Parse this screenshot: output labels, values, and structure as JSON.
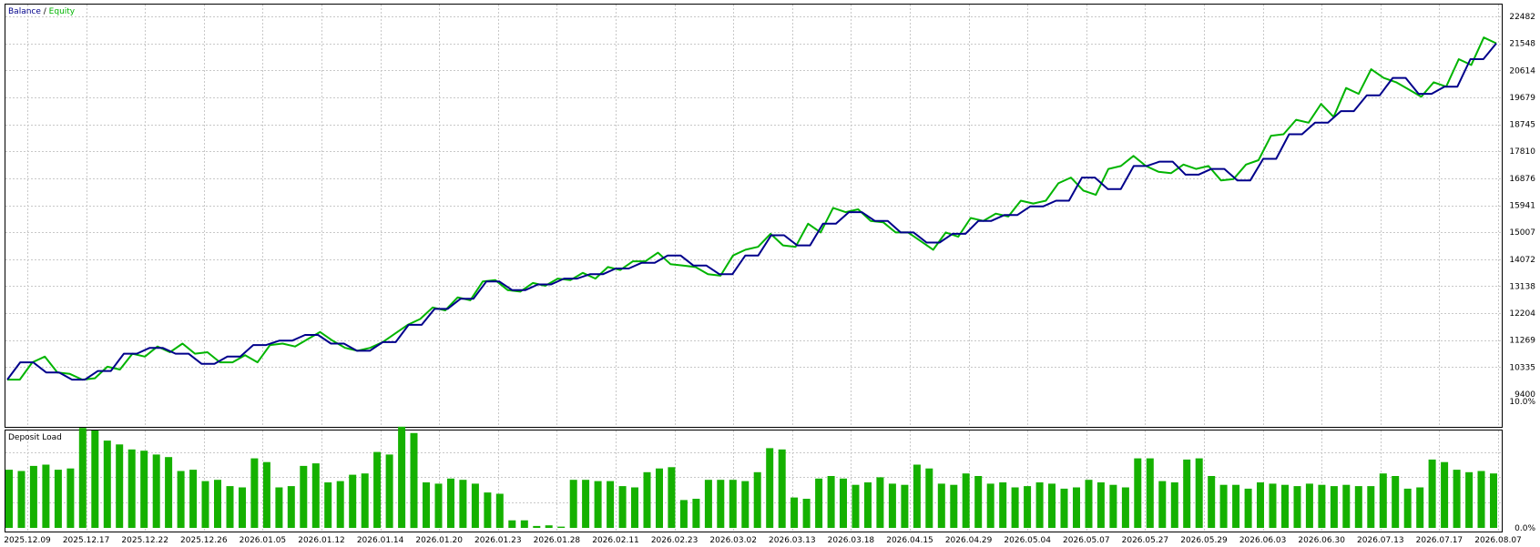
{
  "legend": {
    "balance_label": "Balance",
    "separator": " / ",
    "equity_label": "Equity"
  },
  "colors": {
    "balance": "#00008b",
    "equity": "#00b400",
    "deposit_bar": "#15b100",
    "grid": "#c8c8c8"
  },
  "chart_data": [
    {
      "type": "line",
      "y_ticks": [
        22482,
        21548,
        20614,
        19679,
        18745,
        17810,
        16876,
        15941,
        15007,
        14072,
        13138,
        12204,
        11269,
        10335,
        9400
      ],
      "ylim": [
        9400,
        22482
      ],
      "grid": true,
      "legend": "top-left",
      "series": [
        {
          "name": "Balance",
          "values": [
            9900,
            10500,
            10500,
            10150,
            10150,
            9900,
            9900,
            10200,
            10200,
            10800,
            10800,
            11000,
            11000,
            10800,
            10800,
            10450,
            10450,
            10700,
            10700,
            11100,
            11100,
            11250,
            11250,
            11450,
            11450,
            11150,
            11150,
            10900,
            10900,
            11200,
            11200,
            11800,
            11800,
            12350,
            12350,
            12700,
            12700,
            13300,
            13300,
            13000,
            13000,
            13200,
            13200,
            13400,
            13400,
            13550,
            13550,
            13750,
            13750,
            13950,
            13950,
            14200,
            14200,
            13850,
            13850,
            13550,
            13550,
            14200,
            14200,
            14900,
            14900,
            14550,
            14550,
            15300,
            15300,
            15700,
            15700,
            15400,
            15400,
            15000,
            15000,
            14650,
            14650,
            14950,
            14950,
            15400,
            15400,
            15600,
            15600,
            15900,
            15900,
            16100,
            16100,
            16900,
            16900,
            16500,
            16500,
            17300,
            17300,
            17450,
            17450,
            17000,
            17000,
            17200,
            17200,
            16800,
            16800,
            17550,
            17550,
            18400,
            18400,
            18800,
            18800,
            19200,
            19200,
            19750,
            19750,
            20350,
            20350,
            19800,
            19800,
            20050,
            20050,
            21000,
            21000,
            21550
          ]
        },
        {
          "name": "Equity",
          "values": [
            9900,
            9900,
            10500,
            10700,
            10150,
            10100,
            9900,
            9950,
            10350,
            10250,
            10800,
            10700,
            11050,
            10850,
            11150,
            10800,
            10850,
            10500,
            10500,
            10750,
            10500,
            11100,
            11150,
            11050,
            11300,
            11550,
            11250,
            11000,
            10900,
            11000,
            11200,
            11500,
            11800,
            12000,
            12400,
            12300,
            12750,
            12650,
            13300,
            13350,
            13000,
            12950,
            13250,
            13150,
            13400,
            13350,
            13600,
            13400,
            13800,
            13700,
            14000,
            14000,
            14300,
            13900,
            13850,
            13800,
            13550,
            13500,
            14200,
            14400,
            14500,
            14950,
            14550,
            14500,
            15300,
            15000,
            15850,
            15700,
            15800,
            15400,
            15350,
            15000,
            15000,
            14700,
            14400,
            15000,
            14850,
            15500,
            15400,
            15650,
            15550,
            16100,
            16000,
            16100,
            16700,
            16900,
            16450,
            16300,
            17200,
            17300,
            17650,
            17300,
            17100,
            17050,
            17350,
            17200,
            17300,
            16800,
            16850,
            17350,
            17500,
            18350,
            18400,
            18900,
            18800,
            19450,
            19000,
            20000,
            19800,
            20650,
            20350,
            20200,
            19950,
            19700,
            20200,
            20050,
            21000,
            20800,
            21750,
            21550
          ]
        }
      ]
    },
    {
      "type": "bar",
      "title": "Deposit Load",
      "y_ticks": [
        "10.0%",
        "0.0%"
      ],
      "ylim": [
        0,
        10
      ],
      "grid": true,
      "categories": [
        "2025.12.09",
        "2025.12.17",
        "2025.12.22",
        "2025.12.26",
        "2026.01.05",
        "2026.01.12",
        "2026.01.14",
        "2026.01.20",
        "2026.01.23",
        "2026.01.28",
        "2026.02.11",
        "2026.02.23",
        "2026.03.02",
        "2026.03.13",
        "2026.03.18",
        "2026.04.15",
        "2026.04.29",
        "2026.05.04",
        "2026.05.07",
        "2026.05.27",
        "2026.05.29",
        "2026.06.03",
        "2026.06.30",
        "2026.07.13",
        "2026.07.17",
        "2026.08.07"
      ],
      "values": [
        4.6,
        4.5,
        4.9,
        5.0,
        4.6,
        4.7,
        7.9,
        7.7,
        6.9,
        6.6,
        6.2,
        6.1,
        5.8,
        5.6,
        4.5,
        4.6,
        3.7,
        3.8,
        3.3,
        3.2,
        5.5,
        5.2,
        3.2,
        3.3,
        4.9,
        5.1,
        3.6,
        3.7,
        4.2,
        4.3,
        6.0,
        5.8,
        8.0,
        7.5,
        3.6,
        3.5,
        3.9,
        3.8,
        3.5,
        2.8,
        2.7,
        0.6,
        0.6,
        0.15,
        0.2,
        0.1,
        3.8,
        3.8,
        3.7,
        3.7,
        3.3,
        3.2,
        4.4,
        4.7,
        4.8,
        2.2,
        2.3,
        3.8,
        3.8,
        3.8,
        3.7,
        4.4,
        6.3,
        6.2,
        2.4,
        2.3,
        3.9,
        4.1,
        3.9,
        3.4,
        3.6,
        4.0,
        3.5,
        3.4,
        5.0,
        4.7,
        3.5,
        3.4,
        4.3,
        4.1,
        3.5,
        3.6,
        3.2,
        3.3,
        3.6,
        3.5,
        3.1,
        3.2,
        3.8,
        3.6,
        3.4,
        3.2,
        5.5,
        5.5,
        3.7,
        3.6,
        5.4,
        5.5,
        4.1,
        3.4,
        3.4,
        3.1,
        3.6,
        3.5,
        3.4,
        3.3,
        3.5,
        3.4,
        3.3,
        3.4,
        3.3,
        3.3,
        4.3,
        4.1,
        3.1,
        3.2,
        5.4,
        5.2,
        4.6,
        4.4,
        4.5,
        4.3
      ]
    }
  ]
}
